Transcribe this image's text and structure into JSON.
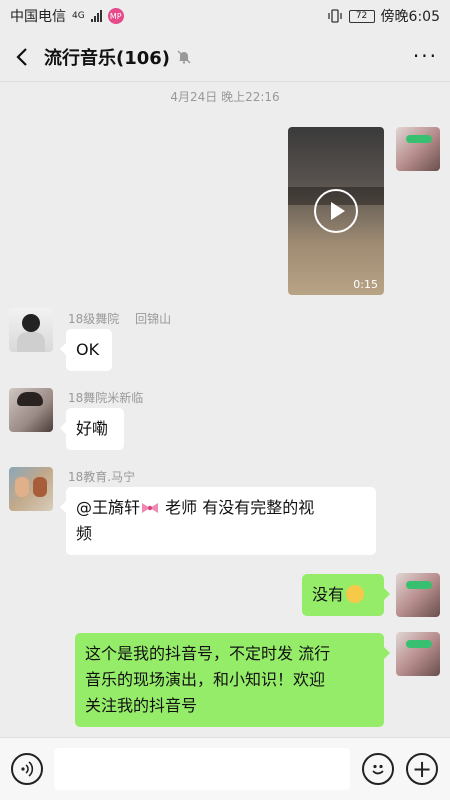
{
  "status_bar": {
    "carrier": "中国电信",
    "network": "4G",
    "mp_badge": "MP",
    "battery": "72",
    "time": "傍晚6:05"
  },
  "header": {
    "title": "流行音乐(106)",
    "back_icon": "back-arrow-icon",
    "mute_icon": "bell-off-icon",
    "more_label": "···"
  },
  "chat": {
    "timestamp": "4月24日 晚上22:16",
    "messages": [
      {
        "direction": "out",
        "type": "video",
        "duration": "0:15"
      },
      {
        "direction": "in",
        "sender": "18级舞院　 回锦山",
        "text": "OK"
      },
      {
        "direction": "in",
        "sender": "18舞院米新临",
        "text": "好嘞"
      },
      {
        "direction": "in",
        "sender": "18教育.马宁",
        "mention": "@王旖轩",
        "text_after": " 老师  有没有完整的视频",
        "line1": " 老师  有没有完整的视",
        "line2": "频"
      },
      {
        "direction": "out",
        "text": "没有"
      },
      {
        "direction": "out",
        "line1": "这个是我的抖音号，不定时发 流行",
        "line2": "音乐的现场演出，和小知识！欢迎",
        "line3": "关注我的抖音号"
      }
    ]
  },
  "input_bar": {
    "placeholder": "",
    "voice_icon": "voice-icon",
    "emoji_icon": "emoji-icon",
    "plus_icon": "plus-icon",
    "plus_label": "+"
  },
  "colors": {
    "background": "#ededed",
    "bubble_out": "#95ec69",
    "bubble_in": "#ffffff",
    "meta_text": "#999999"
  }
}
